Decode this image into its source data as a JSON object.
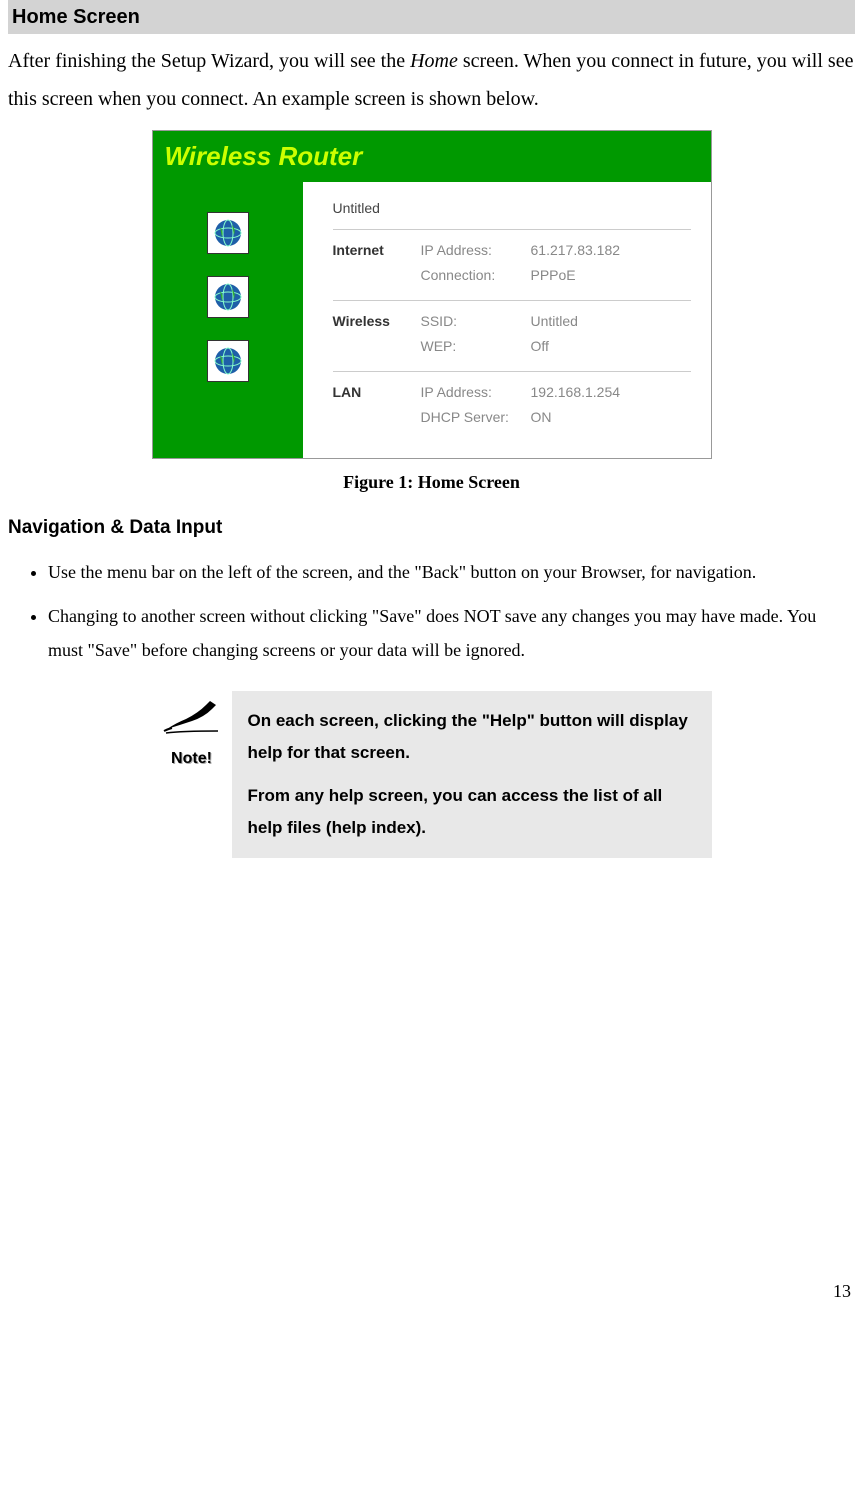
{
  "section_title": "Home Screen",
  "intro_before": "After finishing the Setup Wizard, you will see the ",
  "intro_italic": "Home",
  "intro_after": " screen. When you connect in future, you will see this screen when you connect. An example screen is shown below.",
  "router": {
    "title": "Wireless Router",
    "top_label": "Untitled",
    "rows": [
      {
        "label": "Internet",
        "fields": [
          {
            "key": "IP Address:",
            "val": "61.217.83.182"
          },
          {
            "key": "Connection:",
            "val": "PPPoE"
          }
        ]
      },
      {
        "label": "Wireless",
        "fields": [
          {
            "key": "SSID:",
            "val": "Untitled"
          },
          {
            "key": "WEP:",
            "val": "Off"
          }
        ]
      },
      {
        "label": "LAN",
        "fields": [
          {
            "key": "IP Address:",
            "val": "192.168.1.254"
          },
          {
            "key": "DHCP Server:",
            "val": "ON"
          }
        ]
      }
    ]
  },
  "figure_caption": "Figure 1: Home Screen",
  "subsection_title": "Navigation & Data Input",
  "bullets": [
    "Use the menu bar on the left of the screen, and the \"Back\" button on your Browser, for navigation.",
    "Changing to another screen without clicking \"Save\" does NOT save any changes you may have made. You must \"Save\" before changing screens or your data will be ignored."
  ],
  "note_label": "Note!",
  "note_p1": "On each screen, clicking the \"Help\" button will display help for that screen.",
  "note_p2": "From any help screen, you can access the list of all help files (help index).",
  "page_number": "13"
}
